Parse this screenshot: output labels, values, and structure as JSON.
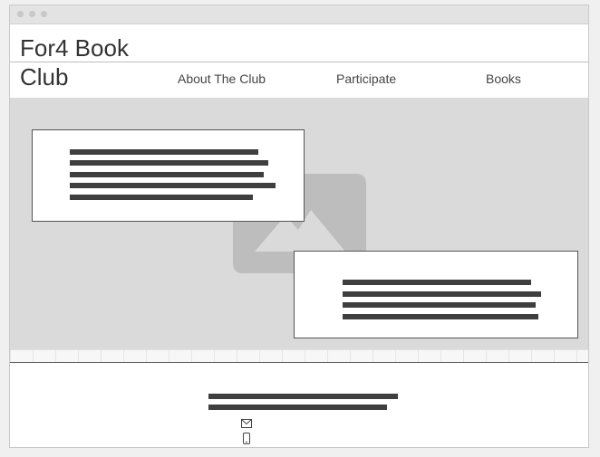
{
  "header": {
    "logo": "For4 Book Club",
    "nav": [
      {
        "label": "About The Club"
      },
      {
        "label": "Participate"
      },
      {
        "label": "Books"
      }
    ]
  },
  "hero": {
    "image_icon": "image-placeholder-icon"
  },
  "footer": {
    "icons": [
      "mail-icon",
      "phone-icon"
    ]
  },
  "colors": {
    "hero_background": "#dadada",
    "text_bar": "#3f3f3f",
    "placeholder_icon": "#bdbdbd"
  }
}
